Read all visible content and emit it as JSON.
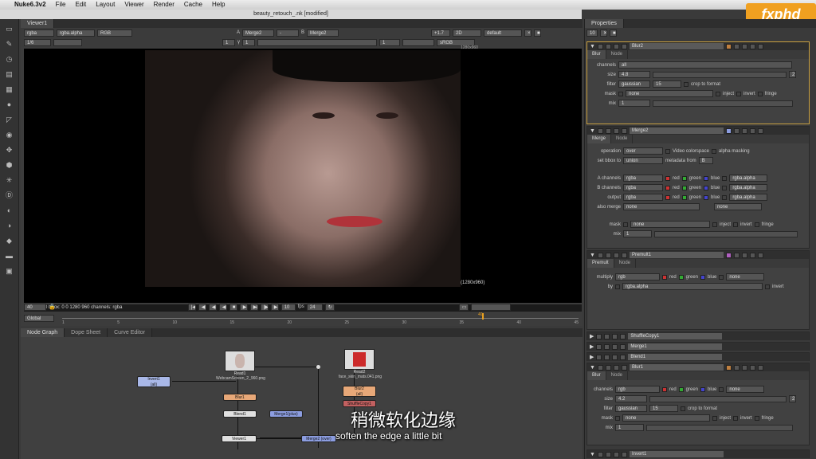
{
  "menubar": {
    "apple": "",
    "app": "Nuke6.3v2",
    "items": [
      "File",
      "Edit",
      "Layout",
      "Viewer",
      "Render",
      "Cache",
      "Help"
    ]
  },
  "window_title": "beauty_retouch_.nk [modified]",
  "logo_text": "fxphd",
  "viewer": {
    "tab": "Viewer1",
    "row1": {
      "channels": "rgba",
      "alpha": "rgba.alpha",
      "mode": "RGB",
      "a_label": "A",
      "a_input": "Merge2",
      "dash": "-",
      "b_label": "B",
      "b_input": "Merge2",
      "gain": "+1.7",
      "view": "2D",
      "lut": "default"
    },
    "row2": {
      "scale": "1/6",
      "gain_val": "1",
      "gamma_label": "γ",
      "gamma_val": "1",
      "proxy": "1",
      "colorspace": "sRGB"
    },
    "format_tl": "1280x960",
    "format_label": "(1280x960)",
    "info": "1280x960  bbox: 0 0 1280 960  channels: rgba",
    "frame": "40",
    "step": "10",
    "fps_label": "fps",
    "fps": "24",
    "range_mode": "Global",
    "timeline_ticks": [
      "1",
      "5",
      "10",
      "15",
      "20",
      "25",
      "30",
      "35",
      "40",
      "45"
    ],
    "timeline_cur": "40",
    "timeline_end": "45"
  },
  "bottom_tabs": [
    "Node Graph",
    "Dope Sheet",
    "Curve Editor"
  ],
  "nodes": {
    "read1": "Read1",
    "read1_file": "WebcamScreen_2_960.png",
    "read2": "Read2",
    "read2_file": "face_skin_mats.041.png",
    "blur1": "Blur1",
    "blur2": "Blur2",
    "blur2_sub": "(all)",
    "blend1": "Blend1",
    "merge1": "Merge1(plus)",
    "merge2": "Merge2 (over)",
    "invert1": "Invert1",
    "invert1_sub": "(all)",
    "viewer1": "Viewer1",
    "shuffle": "ShuffleCopy1"
  },
  "properties": {
    "title": "Properties",
    "max_panels": "10",
    "blur2_panel": {
      "name": "Blur2",
      "tabs": [
        "Blur",
        "Node"
      ],
      "channels_k": "channels",
      "channels_v": "all",
      "size_k": "size",
      "size_v": "4.8",
      "size_n": "2",
      "filter_k": "filter",
      "filter_v": "gaussian",
      "filter_n": "15",
      "crop": "crop to format",
      "mask_k": "mask",
      "mask_v": "none",
      "inject": "inject",
      "invert": "invert",
      "fringe": "fringe",
      "mix_k": "mix",
      "mix_v": "1"
    },
    "merge2_panel": {
      "name": "Merge2",
      "tabs": [
        "Merge",
        "Node"
      ],
      "operation_k": "operation",
      "operation_v": "over",
      "video_cs": "Video colorspace",
      "alpha_masking": "alpha masking",
      "bbox_k": "set bbox to",
      "bbox_v": "union",
      "metadata_k": "metadata from",
      "metadata_v": "B",
      "a_ch_k": "A channels",
      "b_ch_k": "B channels",
      "out_k": "output",
      "ch_v": "rgba",
      "red": "red",
      "green": "green",
      "blue": "blue",
      "alpha_v": "rgba.alpha",
      "also_k": "also merge",
      "also_v": "none",
      "also_v2": "none",
      "mask_k": "mask",
      "mask_v": "none",
      "inject": "inject",
      "invert": "invert",
      "fringe": "fringe",
      "mix_k": "mix",
      "mix_v": "1"
    },
    "premult_panel": {
      "name": "Premult1",
      "tabs": [
        "Premult",
        "Node"
      ],
      "multiply_k": "multiply",
      "multiply_v": "rgb",
      "red": "red",
      "green": "green",
      "blue": "blue",
      "none_v": "none",
      "by_k": "by",
      "by_v": "rgba.alpha",
      "invert": "invert"
    },
    "collapsed": [
      "ShuffleCopy1",
      "Merge1",
      "Blend1"
    ],
    "blur1_panel": {
      "name": "Blur1",
      "tabs": [
        "Blur",
        "Node"
      ],
      "channels_k": "channels",
      "channels_v": "rgb",
      "red": "red",
      "green": "green",
      "blue": "blue",
      "none_v": "none",
      "size_k": "size",
      "size_v": "4.2",
      "size_n": "2",
      "filter_k": "filter",
      "filter_v": "gaussian",
      "filter_n": "15",
      "crop": "crop to format",
      "mask_k": "mask",
      "mask_v": "none",
      "inject": "inject",
      "invert": "invert",
      "fringe": "fringe",
      "mix_k": "mix",
      "mix_v": "1"
    },
    "last_panel": "Invert1"
  },
  "subtitles": {
    "cn": "稍微软化边缘",
    "en": "soften the edge a little bit"
  }
}
